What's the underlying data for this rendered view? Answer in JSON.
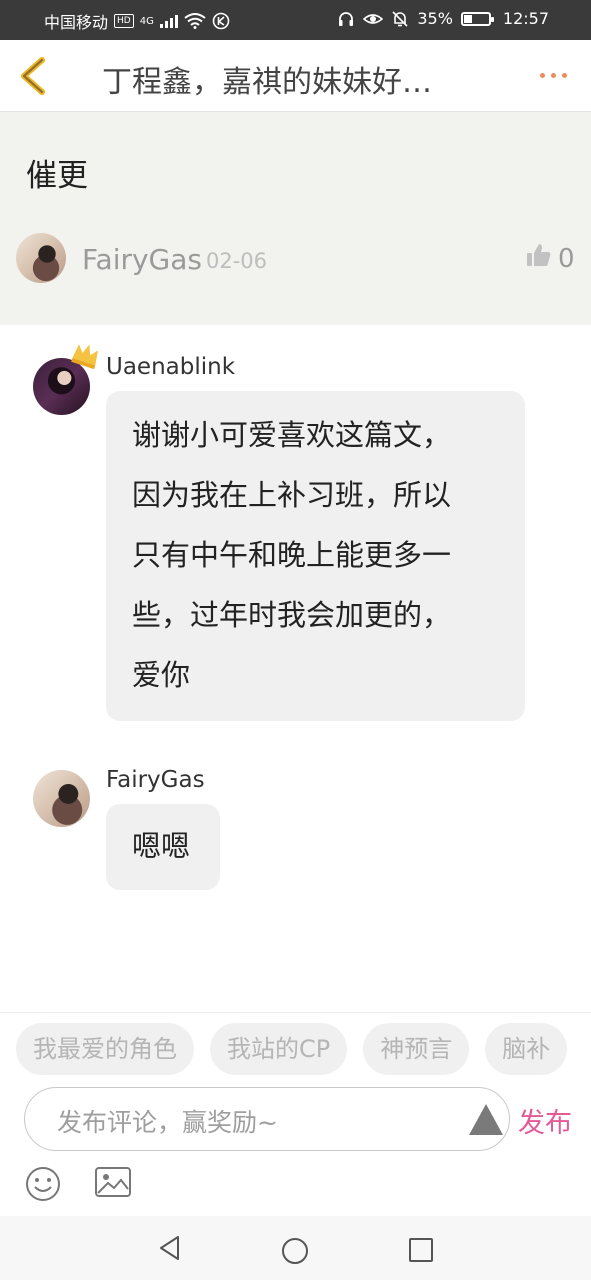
{
  "status_bar": {
    "carrier": "中国移动",
    "hd": "HD",
    "network": "4G",
    "battery_percent_text": "35%",
    "battery_level": 0.35,
    "time": "12:57"
  },
  "header": {
    "title": "丁程鑫，嘉祺的妹妹好…",
    "back_icon": "chevron-left-icon",
    "more_icon": "more-dots-icon",
    "accent_color": "#f0b323"
  },
  "original_comment": {
    "text": "催更",
    "author": "FairyGas",
    "date": "02-06",
    "likes": "0"
  },
  "replies": [
    {
      "author": "Uaenablink",
      "badge_icon": "crown-icon",
      "lines": [
        "谢谢小可爱喜欢这篇文，",
        "因为我在上补习班，所以",
        "只有中午和晚上能更多一",
        "些，过年时我会加更的，",
        "爱你"
      ]
    },
    {
      "author": "FairyGas",
      "lines": [
        "嗯嗯"
      ]
    }
  ],
  "comment_bar": {
    "tags": [
      "我最爱的角色",
      "我站的CP",
      "神预言",
      "脑补"
    ],
    "placeholder": "发布评论，赢奖励~",
    "publish_label": "发布",
    "publish_color": "#e25b97"
  },
  "nav_bar": {
    "icons": [
      "nav-back-icon",
      "nav-home-icon",
      "nav-recent-icon"
    ]
  }
}
